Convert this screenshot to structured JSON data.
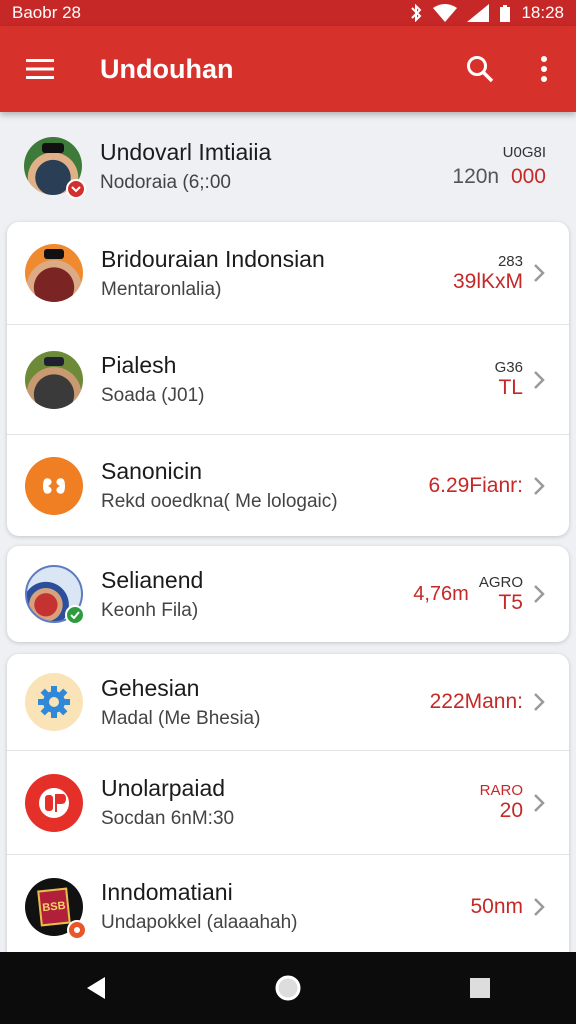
{
  "status_bar": {
    "time_left": "Baobr 28",
    "time_right": "18:28",
    "bg": "#c62828"
  },
  "app_bar": {
    "title": "Undouhan",
    "bg": "#d7312c",
    "menu_icon": "hamburger-icon",
    "search_icon": "search-icon",
    "more_icon": "more-vert-icon"
  },
  "header_item": {
    "primary": "Undovarl Imtiaiia",
    "secondary": "Nodoraia (6;:00",
    "meta_small": "U0G8I",
    "meta_left": "120n",
    "meta_right": "000"
  },
  "card1": [
    {
      "primary": "Bridouraian Indonsian",
      "secondary": "Mentaronlalia)",
      "meta_small": "283",
      "meta_big": "39lKxM"
    },
    {
      "primary": "Pialesh",
      "secondary": "Soada (J01)",
      "meta_small": "G36",
      "meta_big": "TL"
    },
    {
      "primary": "Sanonicin",
      "secondary": "Rekd ooedkna( Me lologaic)",
      "meta_small": "",
      "meta_big": "6.29Fianr:"
    }
  ],
  "card2": [
    {
      "primary": "Selianend",
      "secondary": "Keonh Fila)",
      "meta_small": "AGRO",
      "meta_left": "4,76m",
      "meta_big": "T5"
    }
  ],
  "card3": [
    {
      "primary": "Gehesian",
      "secondary": "Madal (Me Bhesia)",
      "meta_small": "",
      "meta_big": "222Mann:"
    },
    {
      "primary": "Unolarpaiad",
      "secondary": "Socdan 6nM:30",
      "meta_small": "RARO",
      "meta_big": "20"
    },
    {
      "primary": "Inndomatiani",
      "secondary": "Undapokkel (alaaahah)",
      "meta_small": "",
      "meta_big": "50nm"
    }
  ],
  "app_icons": {
    "card3_row3": "BSB"
  },
  "nav_bar": {
    "back_icon": "back-triangle-icon",
    "home_icon": "home-circle-icon",
    "recents_icon": "recents-square-icon"
  }
}
